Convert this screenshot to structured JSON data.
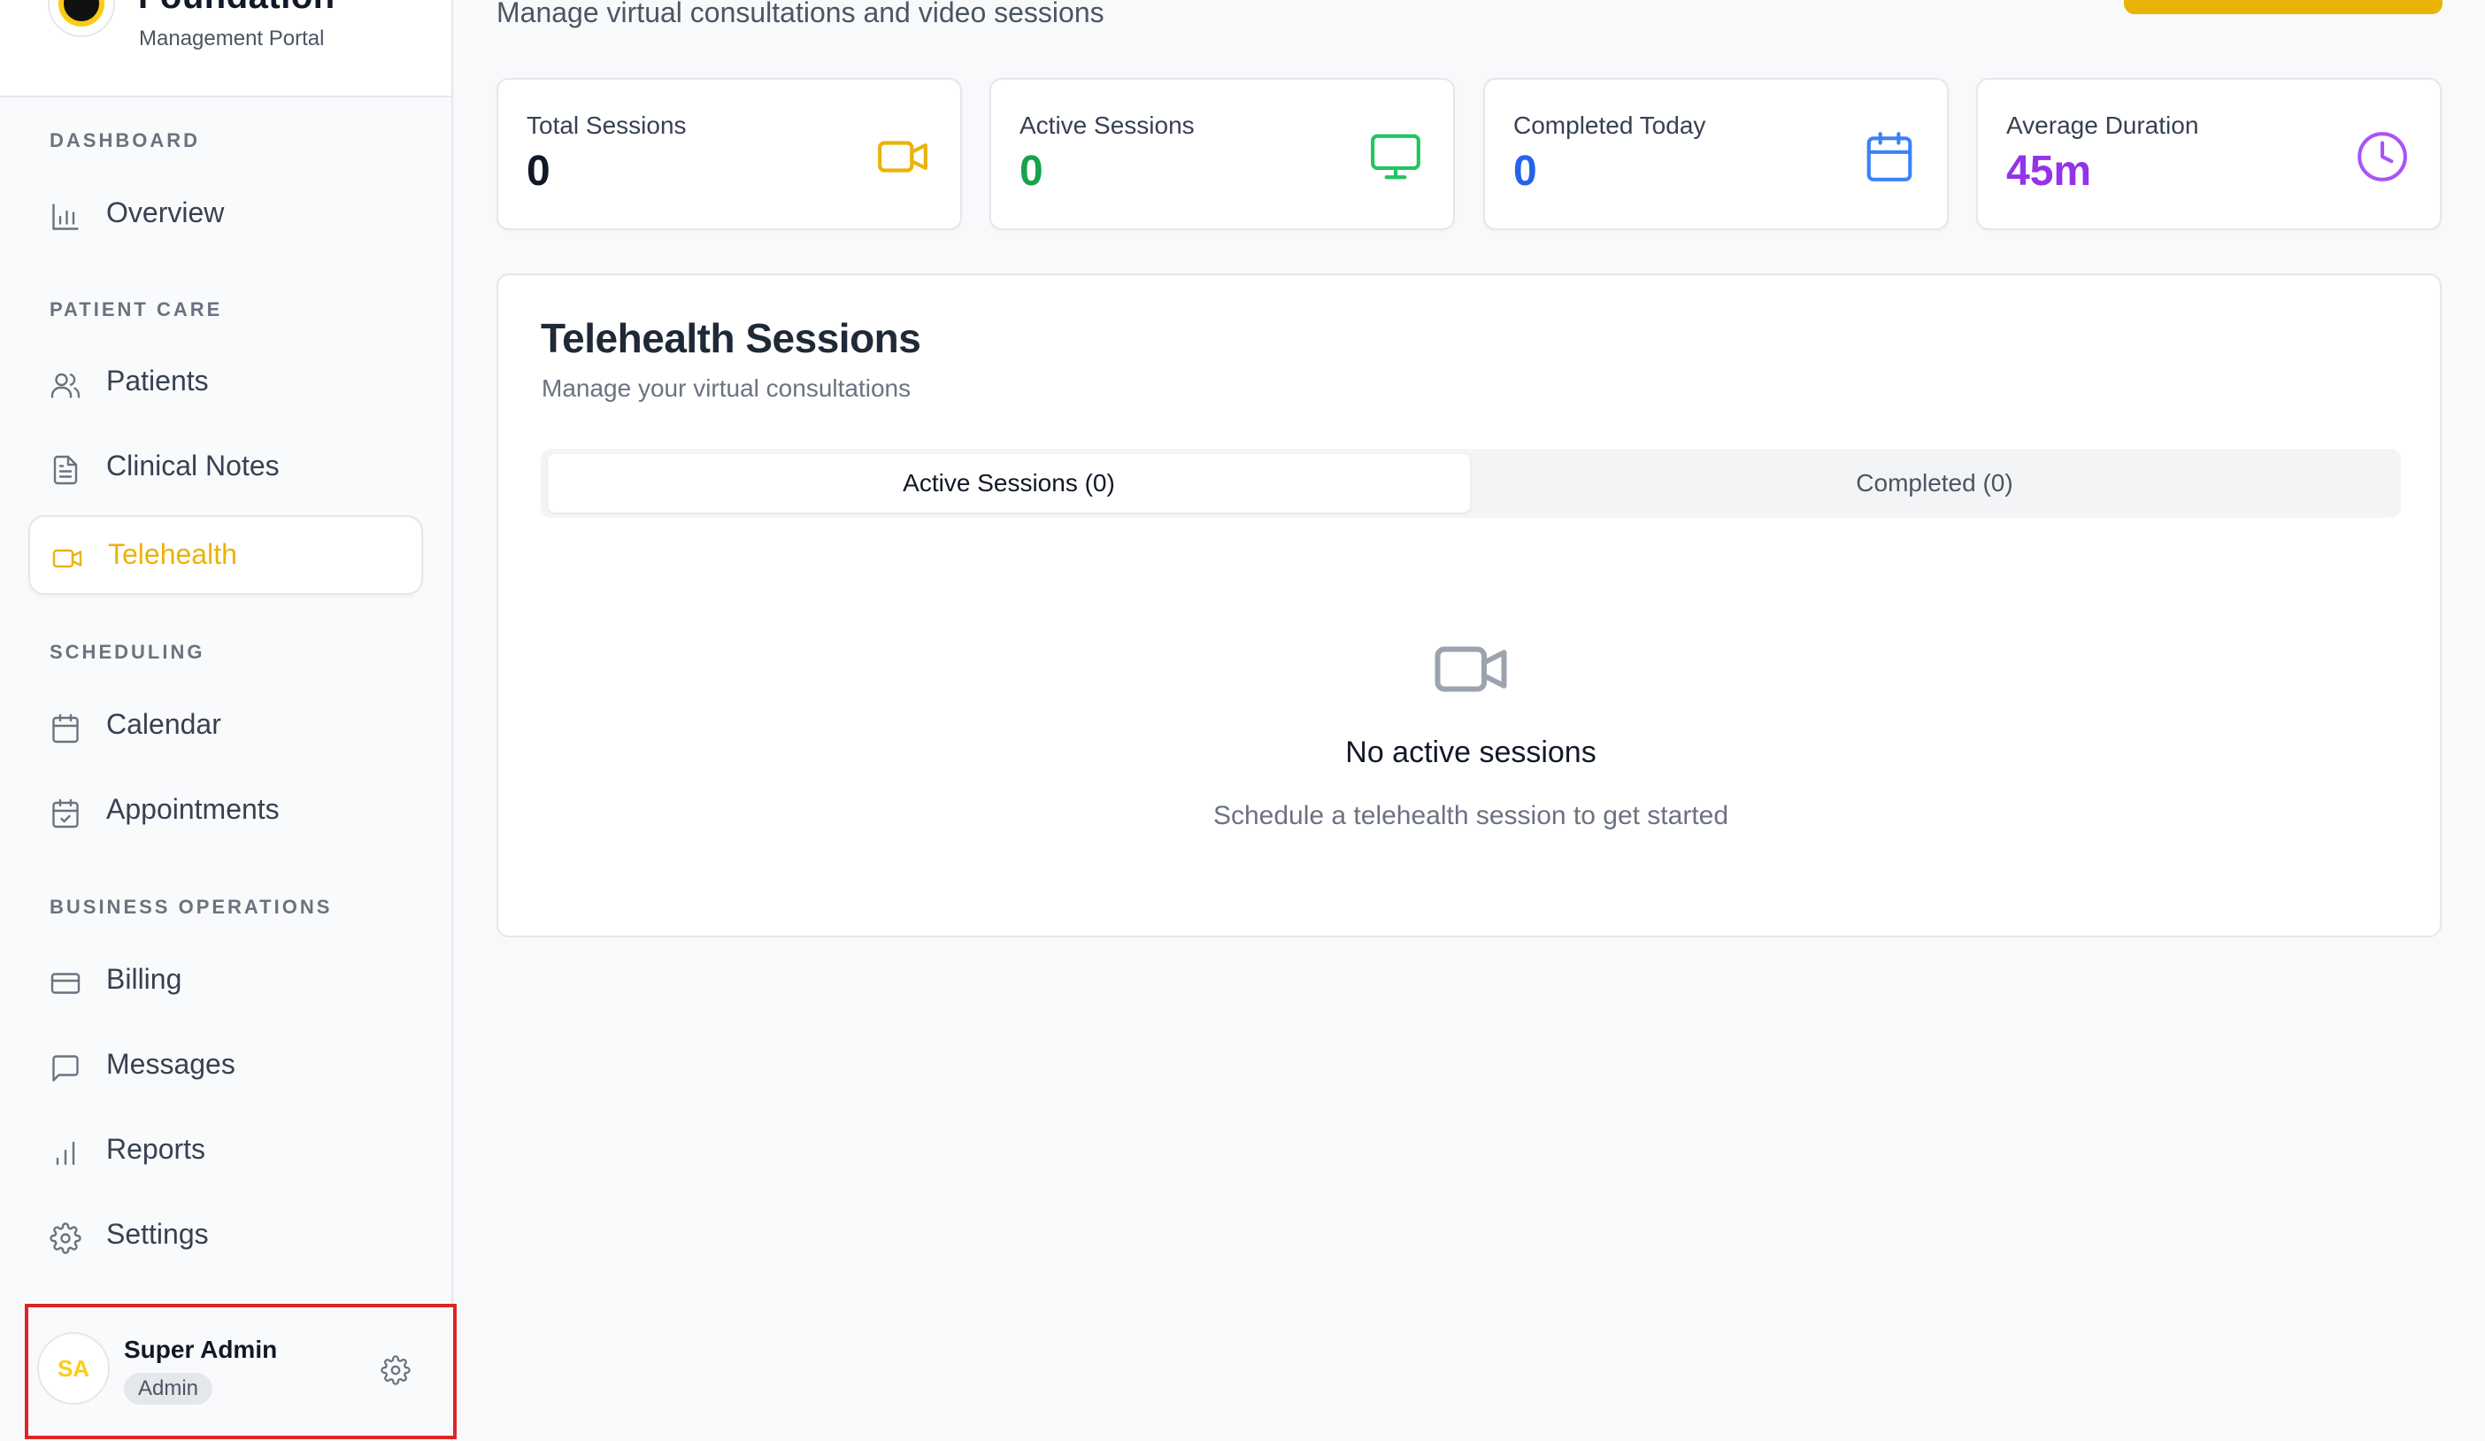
{
  "brand": {
    "title": "Foundation",
    "subtitle": "Management Portal"
  },
  "header": {
    "subtitle": "Manage virtual consultations and video sessions"
  },
  "sidebar": {
    "sections": [
      {
        "label": "DASHBOARD"
      },
      {
        "label": "PATIENT CARE"
      },
      {
        "label": "SCHEDULING"
      },
      {
        "label": "BUSINESS OPERATIONS"
      }
    ],
    "items": [
      {
        "label": "Overview",
        "icon": "bar-chart-icon"
      },
      {
        "label": "Patients",
        "icon": "users-icon"
      },
      {
        "label": "Clinical Notes",
        "icon": "file-text-icon"
      },
      {
        "label": "Telehealth",
        "icon": "video-icon",
        "active": true
      },
      {
        "label": "Calendar",
        "icon": "calendar-icon"
      },
      {
        "label": "Appointments",
        "icon": "calendar-check-icon"
      },
      {
        "label": "Billing",
        "icon": "credit-card-icon"
      },
      {
        "label": "Messages",
        "icon": "message-square-icon"
      },
      {
        "label": "Reports",
        "icon": "bar-chart-icon"
      },
      {
        "label": "Settings",
        "icon": "gear-icon"
      }
    ]
  },
  "user": {
    "initials": "SA",
    "name": "Super Admin",
    "role": "Admin"
  },
  "stats": [
    {
      "label": "Total Sessions",
      "value": "0",
      "color": "#111827",
      "icon": "video-icon",
      "icon_color": "#eab308"
    },
    {
      "label": "Active Sessions",
      "value": "0",
      "color": "#16a34a",
      "icon": "monitor-icon",
      "icon_color": "#22c55e"
    },
    {
      "label": "Completed Today",
      "value": "0",
      "color": "#2563eb",
      "icon": "calendar-icon",
      "icon_color": "#3b82f6"
    },
    {
      "label": "Average Duration",
      "value": "45m",
      "color": "#9333ea",
      "icon": "clock-icon",
      "icon_color": "#a855f7"
    }
  ],
  "panel": {
    "title": "Telehealth Sessions",
    "subtitle": "Manage your virtual consultations",
    "tabs": [
      {
        "label": "Active Sessions (0)",
        "active": true
      },
      {
        "label": "Completed (0)",
        "active": false
      }
    ],
    "empty": {
      "title": "No active sessions",
      "subtitle": "Schedule a telehealth session to get started"
    }
  },
  "colors": {
    "accent": "#eab308",
    "highlight_border": "#dc2626"
  }
}
